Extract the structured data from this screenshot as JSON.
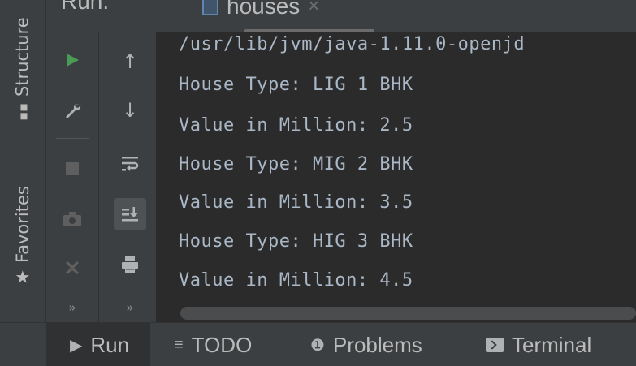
{
  "colors": {
    "run_green": "#499c54",
    "stop_gray": "#6e6e6e",
    "console_text": "#a9b7c6"
  },
  "left_stripe": {
    "structure_label": "Structure",
    "favorites_label": "Favorites"
  },
  "header": {
    "title": "Run:",
    "tab_label": "houses",
    "tab_close": "×"
  },
  "toolbar": {
    "col1_icons": [
      "run-icon",
      "wrench-icon",
      "stop-icon",
      "camera-icon",
      "exit-icon"
    ],
    "col2_icons": [
      "up-arrow-icon",
      "down-arrow-icon",
      "soft-wrap-icon",
      "scroll-to-end-icon",
      "print-icon"
    ],
    "more": "»"
  },
  "console": {
    "lines": [
      "/usr/lib/jvm/java-1.11.0-openjd",
      "House Type: LIG 1 BHK",
      "Value in Million: 2.5",
      "House Type: MIG 2 BHK",
      "Value in Million: 3.5",
      "House Type: HIG 3 BHK",
      "Value in Million: 4.5"
    ]
  },
  "bottom_bar": {
    "run_label": "Run",
    "todo_label": "TODO",
    "problems_label": "Problems",
    "terminal_label": "Terminal"
  }
}
